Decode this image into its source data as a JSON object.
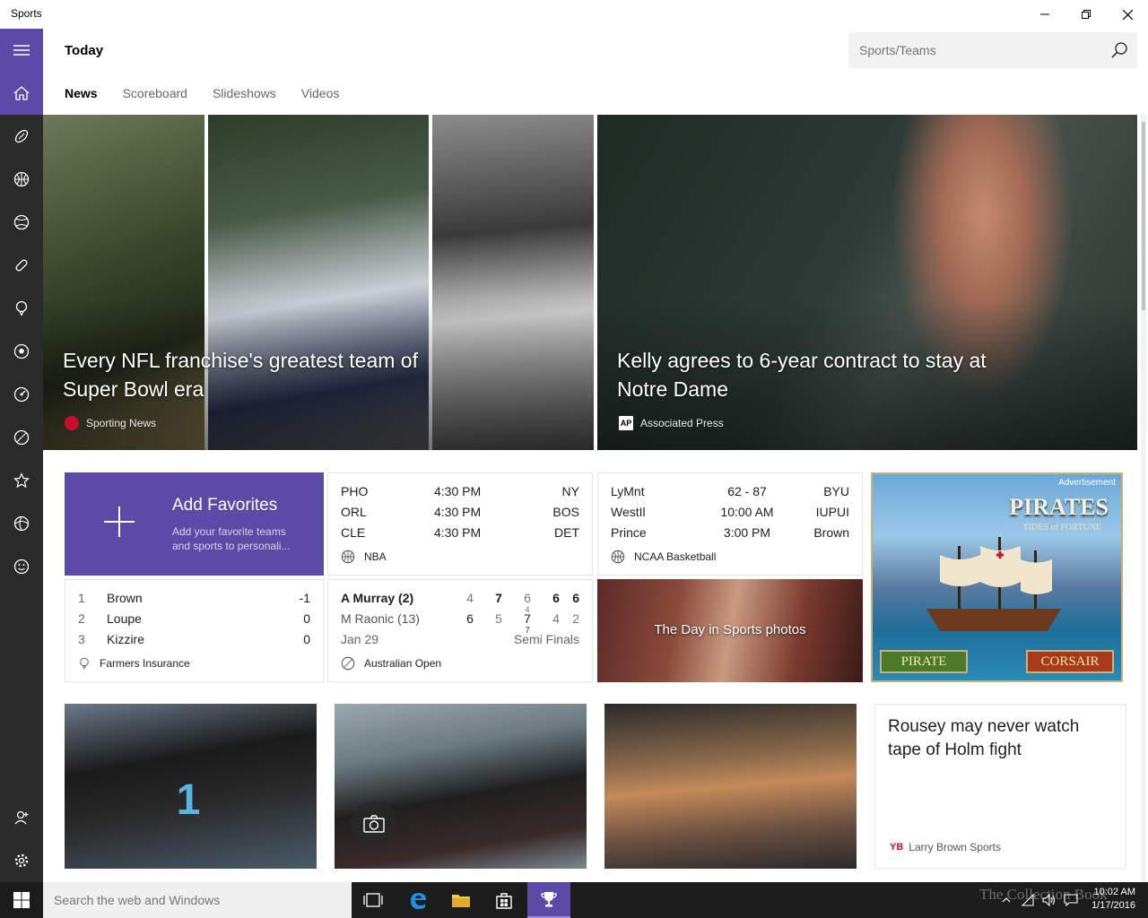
{
  "window": {
    "title": "Sports"
  },
  "header": {
    "page_title": "Today",
    "search_placeholder": "Sports/Teams"
  },
  "tabs": [
    {
      "label": "News",
      "active": true
    },
    {
      "label": "Scoreboard"
    },
    {
      "label": "Slideshows"
    },
    {
      "label": "Videos"
    }
  ],
  "sidebar": {
    "items": [
      "hamburger-menu-icon",
      "home-icon",
      "football-icon",
      "basketball-icon",
      "baseball-icon",
      "hockey-icon",
      "golf-icon",
      "soccer-icon",
      "tennis-icon",
      "racing-icon",
      "favorites-icon",
      "fantasy-icon",
      "emoji-icon",
      "account-icon",
      "settings-icon"
    ]
  },
  "hero": {
    "left": {
      "headline": "Every NFL franchise's greatest team of Super Bowl era",
      "source": "Sporting News"
    },
    "right": {
      "headline": "Kelly agrees to 6-year contract to stay at Notre Dame",
      "source": "Associated Press"
    }
  },
  "favorites": {
    "title": "Add Favorites",
    "subtitle": "Add your favorite teams and sports to personali..."
  },
  "nba": {
    "rows": [
      {
        "home": "PHO",
        "time": "4:30 PM",
        "away": "NY"
      },
      {
        "home": "ORL",
        "time": "4:30 PM",
        "away": "BOS"
      },
      {
        "home": "CLE",
        "time": "4:30 PM",
        "away": "DET"
      }
    ],
    "league": "NBA"
  },
  "ncaa": {
    "rows": [
      {
        "home": "LyMnt",
        "score": "62  -  87",
        "away": "BYU"
      },
      {
        "home": "WestIl",
        "score": "10:00 AM",
        "away": "IUPUI"
      },
      {
        "home": "Prince",
        "score": "3:00 PM",
        "away": "Brown"
      }
    ],
    "league": "NCAA Basketball"
  },
  "golf": {
    "rows": [
      {
        "pos": "1",
        "name": "Brown",
        "score": "-1"
      },
      {
        "pos": "2",
        "name": "Loupe",
        "score": "0"
      },
      {
        "pos": "3",
        "name": "Kizzire",
        "score": "0"
      }
    ],
    "event": "Farmers Insurance"
  },
  "tennis": {
    "p1": {
      "name": "A Murray (2)",
      "sets": [
        "4",
        "7",
        "6",
        "6",
        "6"
      ],
      "tb": [
        "",
        "",
        "4",
        "",
        ""
      ]
    },
    "p2": {
      "name": "M Raonic (13)",
      "sets": [
        "6",
        "5",
        "7",
        "4",
        "2"
      ],
      "tb": [
        "",
        "",
        "7",
        "",
        ""
      ]
    },
    "date": "Jan 29",
    "round": "Semi Finals",
    "event": "Australian Open"
  },
  "photos_tile": {
    "caption": "The Day in Sports photos"
  },
  "ad": {
    "label": "Advertisement",
    "brand": "PIRATES",
    "tagline": "TIDES of FORTUNE",
    "btn_left": "PIRATE",
    "btn_right": "CORSAIR"
  },
  "text_card": {
    "headline": "Rousey may never watch tape of Holm fight",
    "source": "Larry Brown Sports"
  },
  "taskbar": {
    "search_placeholder": "Search the web and Windows",
    "time": "10:02 AM",
    "date": "1/17/2016",
    "watermark": "The Collection Book"
  },
  "colors": {
    "accent": "#5b4aa6",
    "sidebar": "#2b2b2b",
    "taskbar": "#1c1c1c"
  }
}
